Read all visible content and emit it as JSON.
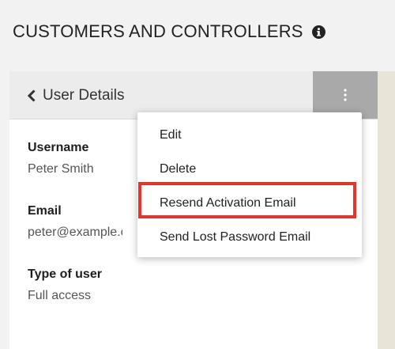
{
  "header": {
    "title": "CUSTOMERS AND CONTROLLERS",
    "info_icon": "info-circle-icon"
  },
  "panel": {
    "back_label": "User Details",
    "back_icon": "chevron-left-icon",
    "menu_icon": "vertical-ellipsis-icon",
    "fields": [
      {
        "label": "Username",
        "value": "Peter Smith"
      },
      {
        "label": "Email",
        "value": "peter@example.com"
      },
      {
        "label": "Type of user",
        "value": "Full access"
      }
    ]
  },
  "dropdown": {
    "items": [
      {
        "label": "Edit"
      },
      {
        "label": "Delete"
      },
      {
        "label": "Resend Activation Email",
        "highlighted": true
      },
      {
        "label": "Send Lost Password Email"
      }
    ]
  },
  "colors": {
    "highlight": "#e8332b",
    "menu_button": "#a9a9a9",
    "panel_header": "#ececec"
  }
}
